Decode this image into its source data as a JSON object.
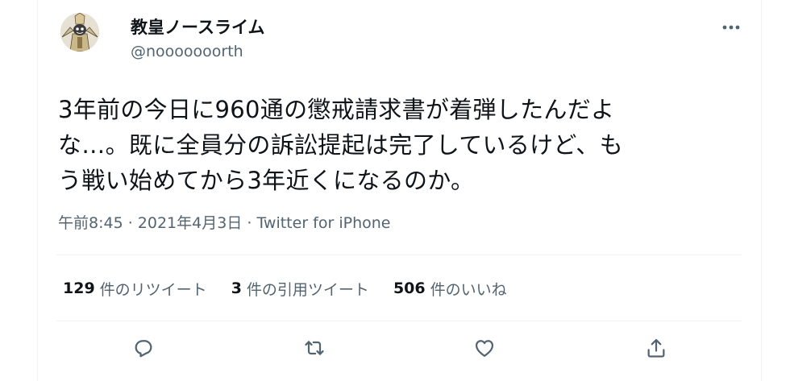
{
  "user": {
    "display_name": "教皇ノースライム",
    "handle": "@nooooooorth"
  },
  "tweet": {
    "text": "3年前の今日に960通の懲戒請求書が着弾したんだよ\nな…。既に全員分の訴訟提起は完了しているけど、も\nう戦い始めてから3年近くになるのか。",
    "time": "午前8:45",
    "separator1": " · ",
    "date": "2021年4月3日",
    "separator2": " · ",
    "source": "Twitter for iPhone"
  },
  "stats": {
    "retweets": {
      "count": "129",
      "label": "件のリツイート"
    },
    "quotes": {
      "count": "3",
      "label": "件の引用ツイート"
    },
    "likes": {
      "count": "506",
      "label": "件のいいね"
    }
  },
  "icons": {
    "more": "more-icon",
    "reply": "reply-icon",
    "retweet": "retweet-icon",
    "like": "like-icon",
    "share": "share-icon"
  },
  "colors": {
    "text": "#0f1419",
    "secondary": "#536471",
    "divider": "#eff3f4"
  }
}
